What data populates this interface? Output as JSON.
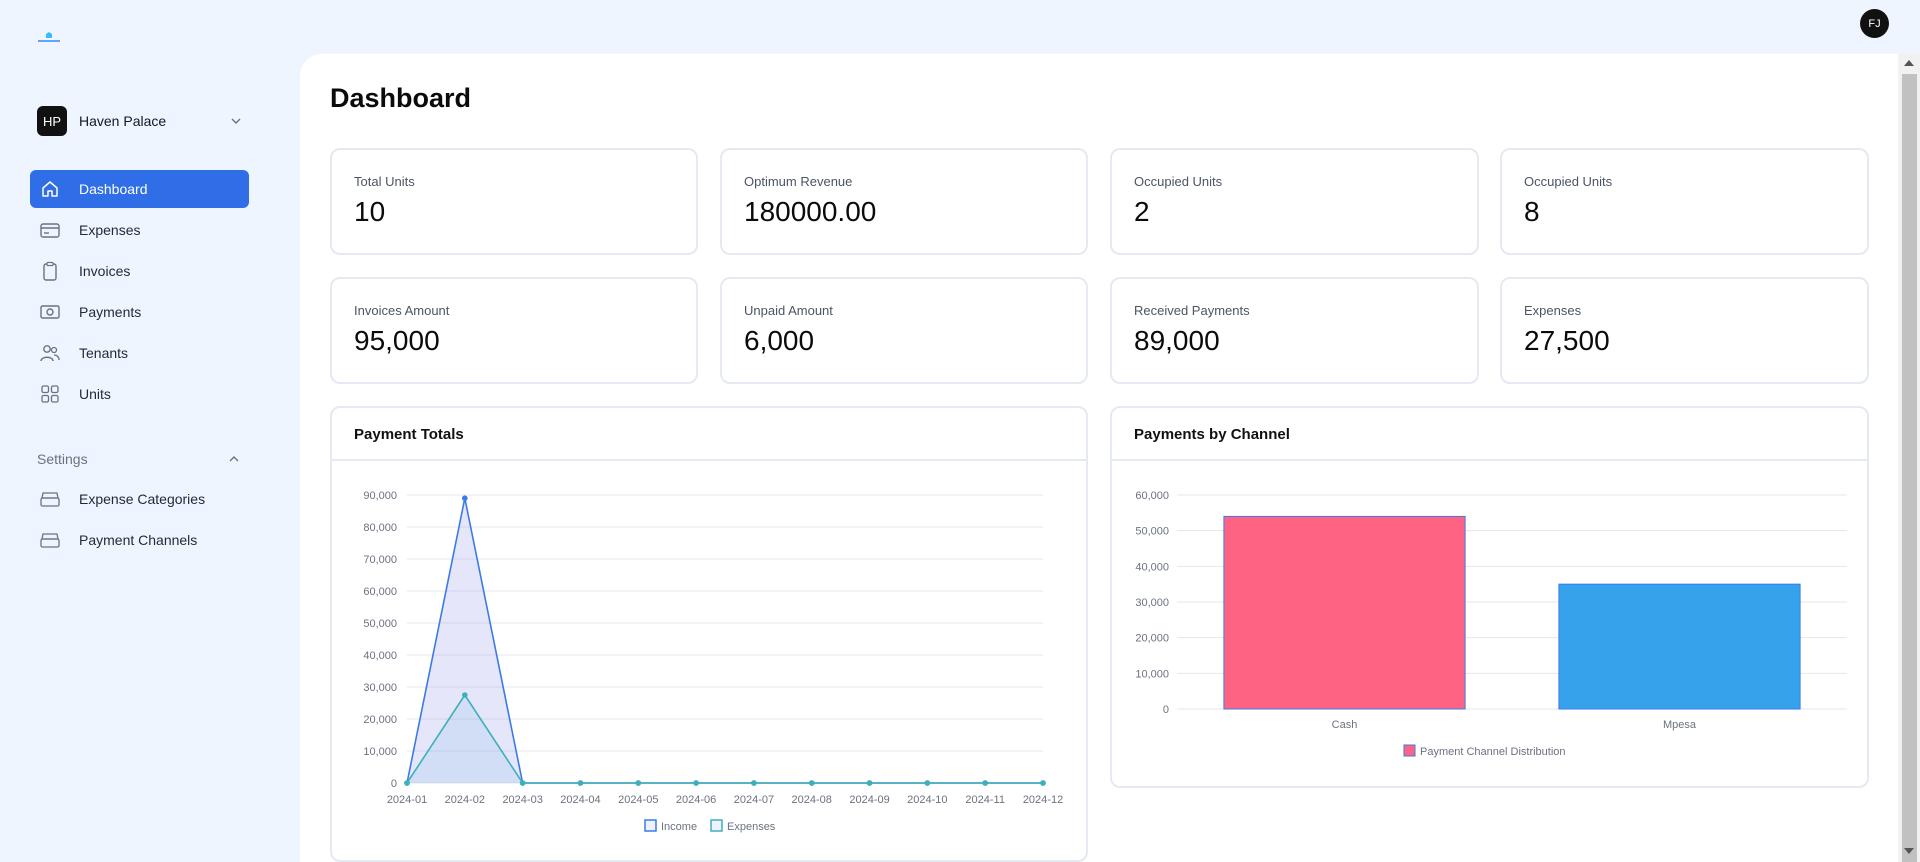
{
  "header": {
    "avatar_initials": "FJ"
  },
  "sidebar": {
    "property": {
      "initials": "HP",
      "name": "Haven Palace"
    },
    "items": [
      {
        "label": "Dashboard",
        "icon": "home-icon",
        "active": true
      },
      {
        "label": "Expenses",
        "icon": "credit-card-icon"
      },
      {
        "label": "Invoices",
        "icon": "clipboard-icon"
      },
      {
        "label": "Payments",
        "icon": "banknote-icon"
      },
      {
        "label": "Tenants",
        "icon": "users-icon"
      },
      {
        "label": "Units",
        "icon": "grid-icon"
      }
    ],
    "settings_label": "Settings",
    "settings_items": [
      {
        "label": "Expense Categories",
        "icon": "archive-icon"
      },
      {
        "label": "Payment Channels",
        "icon": "archive-icon"
      }
    ]
  },
  "main": {
    "title": "Dashboard",
    "stats": [
      {
        "label": "Total Units",
        "value": "10"
      },
      {
        "label": "Optimum Revenue",
        "value": "180000.00"
      },
      {
        "label": "Occupied Units",
        "value": "2"
      },
      {
        "label": "Occupied Units",
        "value": "8"
      },
      {
        "label": "Invoices Amount",
        "value": "95,000"
      },
      {
        "label": "Unpaid Amount",
        "value": "6,000"
      },
      {
        "label": "Received Payments",
        "value": "89,000"
      },
      {
        "label": "Expenses",
        "value": "27,500"
      }
    ],
    "payment_totals_title": "Payment Totals",
    "payments_by_channel_title": "Payments by Channel"
  },
  "colors": {
    "accent": "#2f6ee6",
    "income": "#3b7be6",
    "expenses": "#3fb0b8",
    "cash": "#ff6384",
    "mpesa": "#36a2eb"
  },
  "chart_data": [
    {
      "type": "line",
      "title": "Payment Totals",
      "x": [
        "2024-01",
        "2024-02",
        "2024-03",
        "2024-04",
        "2024-05",
        "2024-06",
        "2024-07",
        "2024-08",
        "2024-09",
        "2024-10",
        "2024-11",
        "2024-12"
      ],
      "series": [
        {
          "name": "Income",
          "values": [
            0,
            89000,
            0,
            0,
            0,
            0,
            0,
            0,
            0,
            0,
            0,
            0
          ]
        },
        {
          "name": "Expenses",
          "values": [
            0,
            27500,
            0,
            0,
            0,
            0,
            0,
            0,
            0,
            0,
            0,
            0
          ]
        }
      ],
      "ylim": [
        0,
        90000
      ],
      "yticks": [
        0,
        10000,
        20000,
        30000,
        40000,
        50000,
        60000,
        70000,
        80000,
        90000
      ],
      "ytick_labels": [
        "0",
        "10,000",
        "20,000",
        "30,000",
        "40,000",
        "50,000",
        "60,000",
        "70,000",
        "80,000",
        "90,000"
      ],
      "grid": true,
      "legend": "bottom"
    },
    {
      "type": "bar",
      "title": "Payments by Channel",
      "categories": [
        "Cash",
        "Mpesa"
      ],
      "series": [
        {
          "name": "Payment Channel Distribution",
          "values": [
            54000,
            35000
          ]
        }
      ],
      "ylim": [
        0,
        60000
      ],
      "yticks": [
        0,
        10000,
        20000,
        30000,
        40000,
        50000,
        60000
      ],
      "ytick_labels": [
        "0",
        "10,000",
        "20,000",
        "30,000",
        "40,000",
        "50,000",
        "60,000"
      ],
      "grid": true,
      "legend": "bottom"
    }
  ]
}
